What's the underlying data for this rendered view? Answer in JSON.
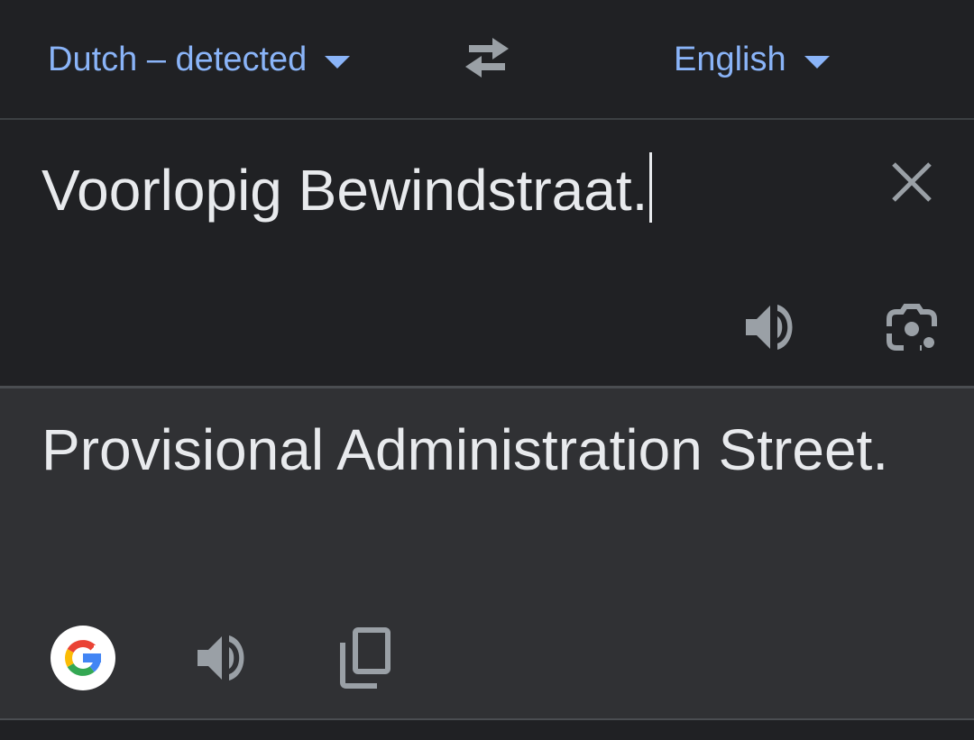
{
  "languages": {
    "source_label": "Dutch – detected",
    "target_label": "English"
  },
  "input": {
    "text": "Voorlopig Bewindstraat."
  },
  "output": {
    "text": "Provisional Administration Street."
  },
  "icons": {
    "source_dropdown": "caret-down-icon",
    "swap": "swap-arrows-icon",
    "target_dropdown": "caret-down-icon",
    "clear": "close-icon",
    "listen_source": "volume-icon",
    "camera": "camera-lens-icon",
    "google": "google-g-icon",
    "listen_target": "volume-icon",
    "copy": "copy-icon"
  },
  "colors": {
    "background": "#202124",
    "output_background": "#303134",
    "accent": "#8ab4f8",
    "text": "#e8eaed",
    "icon": "#9aa0a6"
  }
}
